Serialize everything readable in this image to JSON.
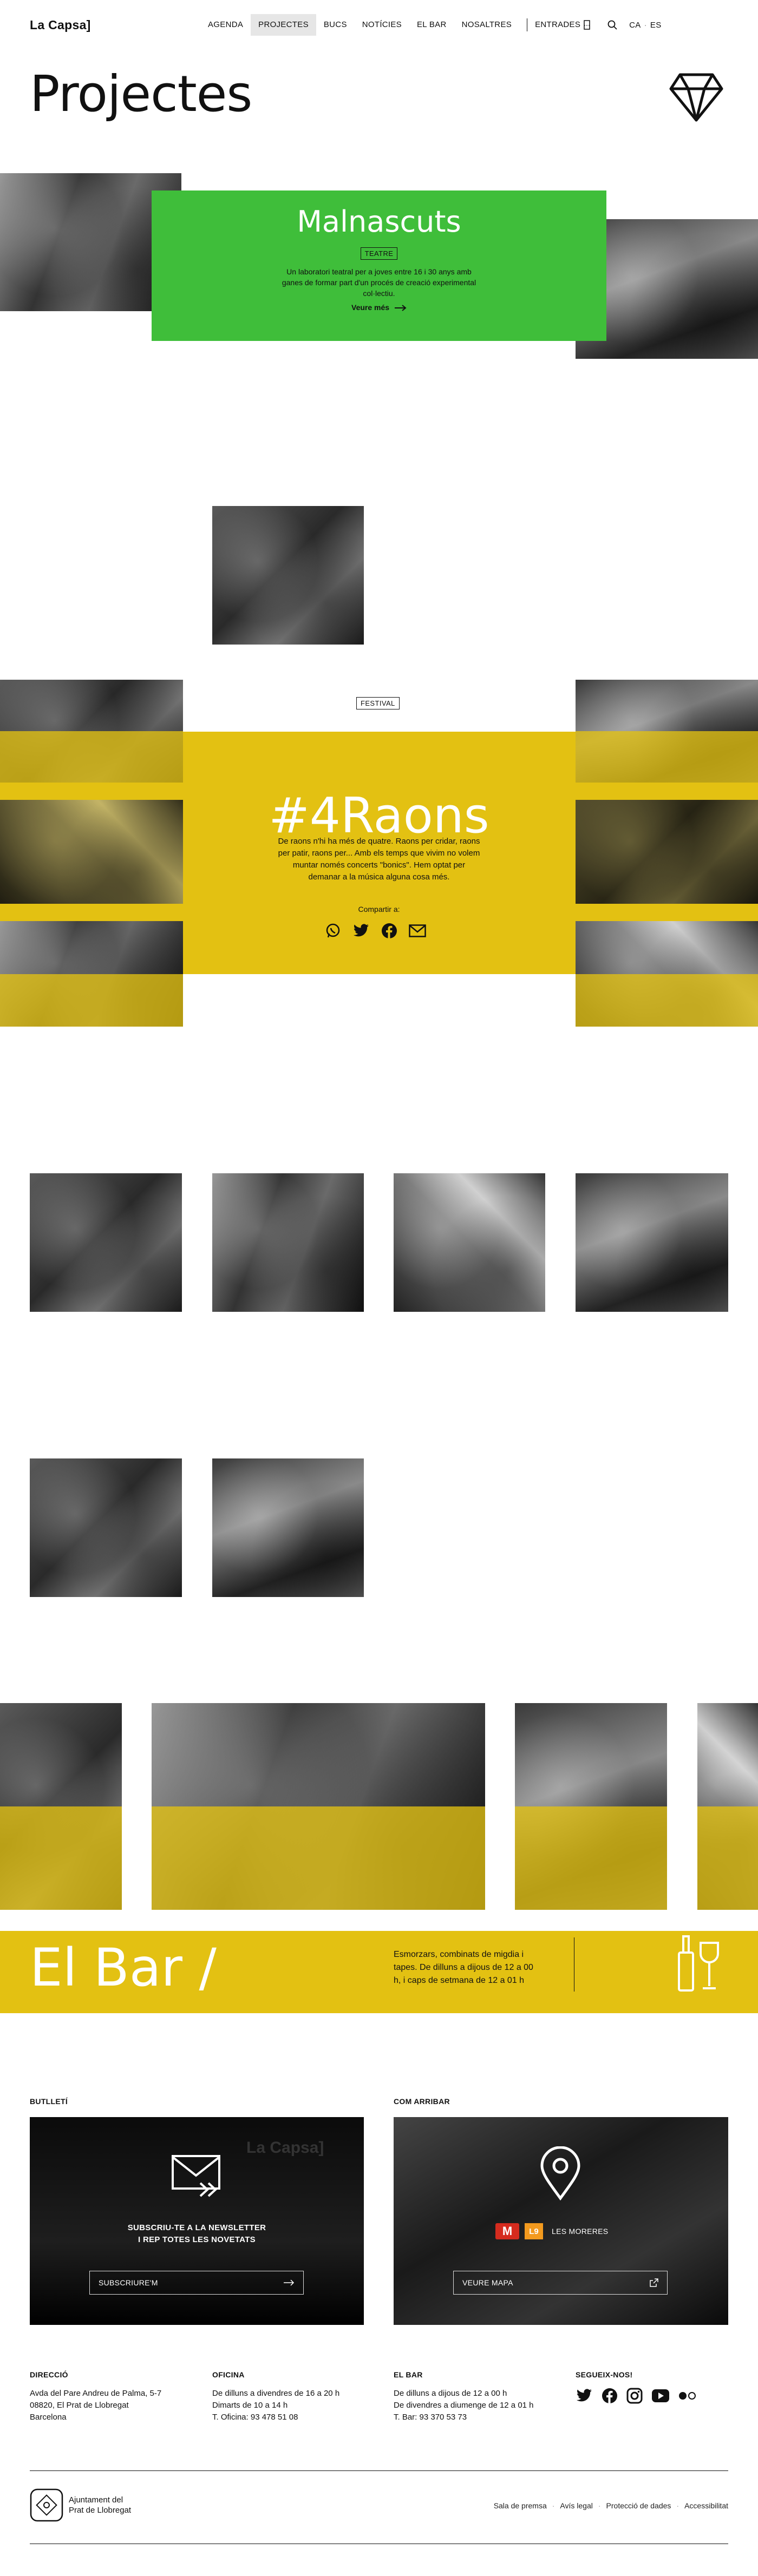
{
  "header": {
    "logo": "La Capsa]",
    "nav": [
      "AGENDA",
      "PROJECTES",
      "BUCS",
      "NOTÍCIES",
      "EL BAR",
      "NOSALTRES"
    ],
    "entrades": "ENTRADES",
    "lang_ca": "CA",
    "lang_sep": "·",
    "lang_es": "ES"
  },
  "page": {
    "title": "Projectes"
  },
  "malnascuts": {
    "title": "Malnascuts",
    "tag": "TEATRE",
    "description": "Un laboratori teatral per a joves entre 16 i 30 anys amb ganes de formar part d'un procés de creació experimental col·lectiu.",
    "more": "Veure més"
  },
  "raons": {
    "tag": "FESTIVAL",
    "title": "#4Raons",
    "description": "De raons n'hi ha més de quatre. Raons per cridar, raons per patir, raons per... Amb els temps que vivim no volem muntar només concerts \"bonics\". Hem optat per demanar a la música alguna cosa més.",
    "share": "Compartir a:"
  },
  "bar": {
    "title": "El Bar /",
    "description": "Esmorzars, combinats de migdia i tapes. De dilluns a dijous de 12 a 00 h, i caps de setmana de 12 a 01 h"
  },
  "newsletter": {
    "label": "BUTLLETÍ",
    "text1": "SUBSCRIU-TE A LA NEWSLETTER",
    "text2": "I REP TOTES LES NOVETATS",
    "button": "SUBSCRIURE'M"
  },
  "arrive": {
    "label": "COM ARRIBAR",
    "metro_m": "M",
    "metro_line": "L9",
    "station": "LES MORERES",
    "button": "VEURE MAPA"
  },
  "info": {
    "direccio": {
      "label": "DIRECCIÓ",
      "lines": [
        "Avda del Pare Andreu de Palma, 5-7",
        "08820, El Prat de Llobregat",
        "Barcelona"
      ]
    },
    "oficina": {
      "label": "OFICINA",
      "lines": [
        "De dilluns a divendres de 16 a 20 h",
        "Dimarts de 10 a 14 h",
        "T. Oficina: 93 478 51 08"
      ]
    },
    "elbar": {
      "label": "EL BAR",
      "lines": [
        "De dilluns a dijous de 12 a 00 h",
        "De divendres a diumenge de 12 a 01 h",
        "T. Bar: 93 370 53 73"
      ]
    },
    "segueix": {
      "label": "SEGUEIX-NOS!"
    }
  },
  "footer": {
    "ajuntament1": "Ajuntament del",
    "ajuntament2": "Prat de Llobregat",
    "links": [
      "Sala de premsa",
      "Avís legal",
      "Protecció de dades",
      "Accessibilitat"
    ],
    "dot": "·"
  },
  "colors": {
    "green": "#3fbe3a",
    "yellow": "#e3c112",
    "black": "#000000"
  },
  "icons": [
    "search-icon",
    "ticket-icon",
    "diamond-icon",
    "whatsapp-icon",
    "twitter-icon",
    "facebook-icon",
    "mail-icon",
    "arrow-right-icon",
    "external-link-icon",
    "map-pin-icon",
    "wine-icon",
    "instagram-icon",
    "youtube-icon",
    "flickr-icon"
  ]
}
